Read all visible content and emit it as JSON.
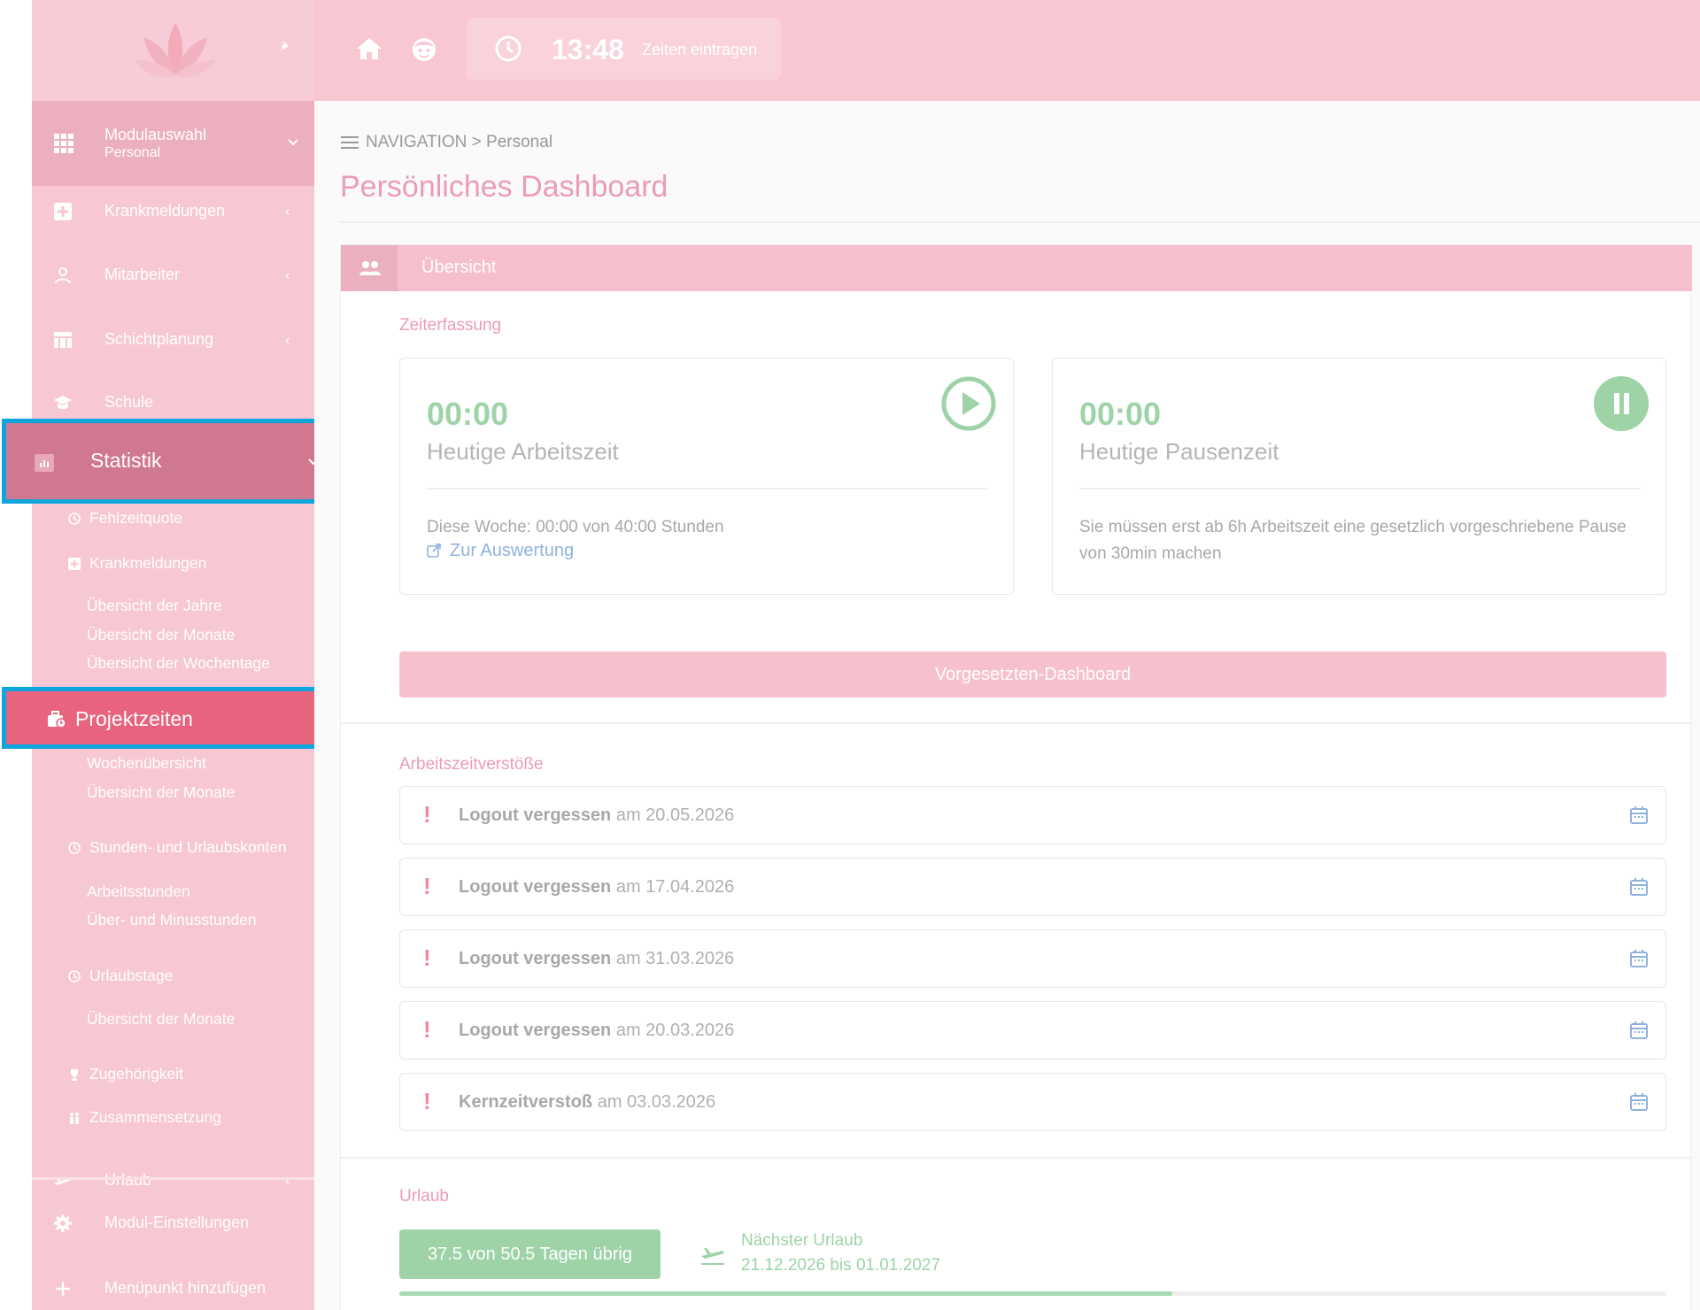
{
  "topbar": {
    "time": "13:48",
    "time_action": "Zeiten eintragen"
  },
  "sidebar": {
    "module_switch": {
      "label": "Modulauswahl",
      "current": "Personal"
    },
    "top_items": [
      {
        "label": "Krankmeldungen",
        "icon": "medical-plus-icon"
      },
      {
        "label": "Mitarbeiter",
        "icon": "user-icon"
      },
      {
        "label": "Schichtplanung",
        "icon": "table-icon"
      },
      {
        "label": "Schule",
        "icon": "graduation-cap-icon"
      }
    ],
    "statistik": {
      "label": "Statistik",
      "icon": "chart-icon"
    },
    "statistik_children": [
      {
        "label": "Fehlzeitquote",
        "icon": "history-icon"
      },
      {
        "label": "Krankmeldungen",
        "icon": "medical-plus-icon"
      },
      {
        "label": "Übersicht der Jahre"
      },
      {
        "label": "Übersicht der Monate"
      },
      {
        "label": "Übersicht der Wochentage"
      }
    ],
    "projektzeiten": {
      "label": "Projektzeiten",
      "icon": "briefcase-clock-icon"
    },
    "projekt_children": [
      {
        "label": "Wochenübersicht"
      },
      {
        "label": "Übersicht der Monate"
      },
      {
        "label": "Stunden- und Urlaubskonten",
        "icon": "history-icon"
      },
      {
        "label": "Arbeitsstunden"
      },
      {
        "label": "Über- und Minusstunden"
      },
      {
        "label": "Urlaubstage",
        "icon": "history-icon"
      },
      {
        "label": "Übersicht der Monate"
      },
      {
        "label": "Zugehörigkeit",
        "icon": "trophy-icon"
      },
      {
        "label": "Zusammensetzung",
        "icon": "people-icon"
      }
    ],
    "urlaub": {
      "label": "Urlaub"
    },
    "settings": {
      "label": "Modul-Einstellungen"
    },
    "add_item": {
      "label": "Menüpunkt hinzufügen"
    }
  },
  "breadcrumb": {
    "root": "NAVIGATION",
    "separator": ">",
    "current": "Personal"
  },
  "page_title": "Persönliches Dashboard",
  "overview": {
    "header": "Übersicht",
    "time_section_label": "Zeiterfassung",
    "work": {
      "value": "00:00",
      "label": "Heutige Arbeitszeit",
      "week_info": "Diese Woche: 00:00 von 40:00 Stunden",
      "link": "Zur Auswertung"
    },
    "pause": {
      "value": "00:00",
      "label": "Heutige Pausenzeit",
      "info": "Sie müssen erst ab 6h Arbeitszeit eine gesetzlich vorgeschriebene Pause von 30min machen"
    },
    "boss_button": "Vorgesetzten-Dashboard",
    "violations_label": "Arbeitszeitverstöße",
    "violations": [
      {
        "type": "Logout vergessen",
        "text": "am 20.05.2026"
      },
      {
        "type": "Logout vergessen",
        "text": "am 17.04.2026"
      },
      {
        "type": "Logout vergessen",
        "text": "am 31.03.2026"
      },
      {
        "type": "Logout vergessen",
        "text": "am 20.03.2026"
      },
      {
        "type": "Kernzeitverstoß",
        "text": "am 03.03.2026"
      }
    ],
    "vacation_label": "Urlaub",
    "vacation_badge": "37.5 von 50.5 Tagen übrig",
    "next_vacation_label": "Nächster Urlaub",
    "next_vacation_dates": "21.12.2026 bis 01.01.2027",
    "vacation_remaining_fraction": 0.61
  },
  "colors": {
    "accent_pink": "#ec9cb2",
    "success_green": "#9ed3a7",
    "highlight_border": "#0ea5dd",
    "active_item": "#e8637e"
  }
}
